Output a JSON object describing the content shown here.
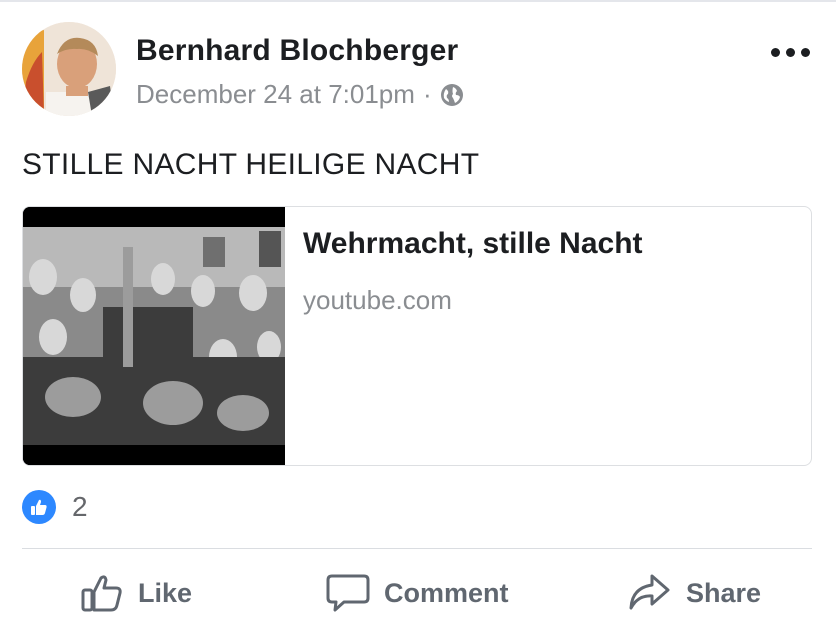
{
  "post": {
    "author": "Bernhard Blochberger",
    "timestamp": "December 24 at 7:01pm",
    "separator": "·",
    "privacy_icon": "globe-icon",
    "text": "STILLE NACHT HEILIGE NACHT"
  },
  "link_preview": {
    "title": "Wehrmacht, stille Nacht",
    "domain": "youtube.com"
  },
  "reactions": {
    "icon": "like-icon",
    "count": "2"
  },
  "actions": {
    "like_label": "Like",
    "comment_label": "Comment",
    "share_label": "Share"
  },
  "colors": {
    "like_blue": "#2d88ff",
    "text_primary": "#1c1e21",
    "text_secondary": "#8a8d91",
    "action_gray": "#606770"
  }
}
